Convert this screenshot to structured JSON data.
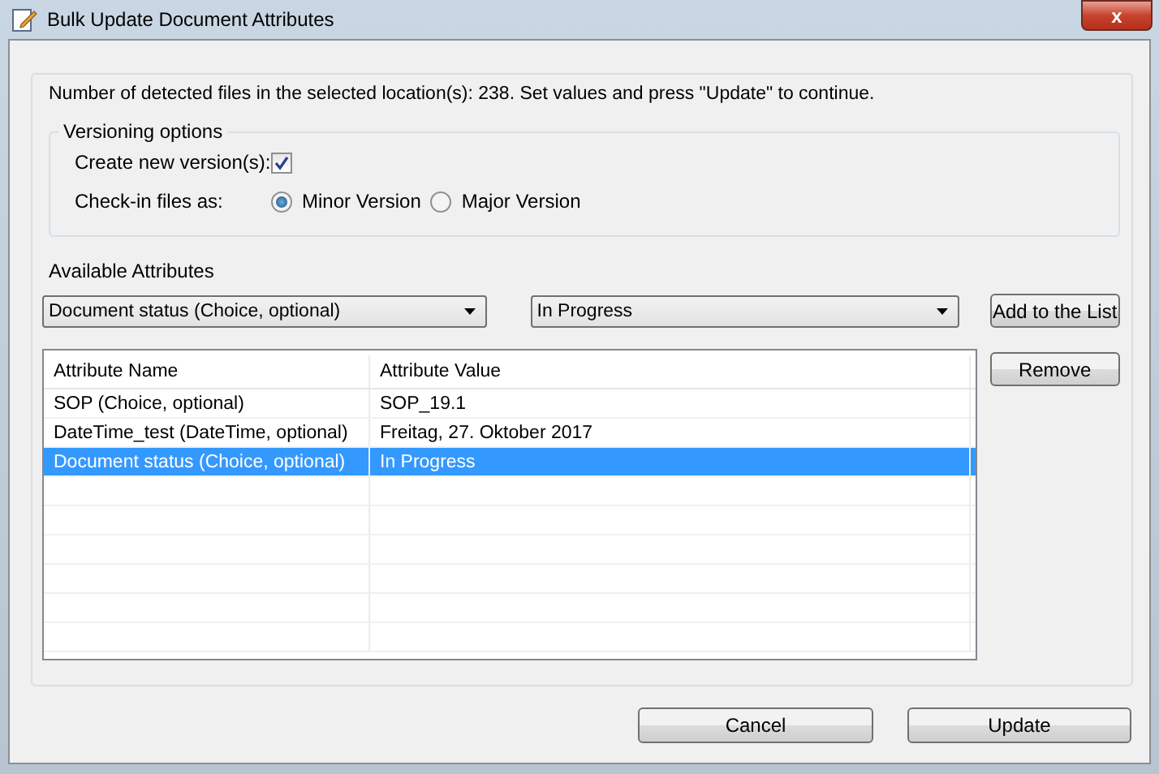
{
  "window": {
    "title": "Bulk Update Document Attributes",
    "close_label": "x"
  },
  "info_text": "Number of detected files in the selected location(s): 238.  Set values and press \"Update\" to continue.",
  "versioning": {
    "title": "Versioning options",
    "create_label": "Create new version(s):",
    "create_checked": true,
    "checkin_label": "Check-in files as:",
    "options": [
      {
        "label": "Minor Version",
        "selected": true
      },
      {
        "label": "Major Version",
        "selected": false
      }
    ]
  },
  "available_label": "Available Attributes",
  "attribute_dropdown": {
    "value": "Document status (Choice, optional)"
  },
  "value_dropdown": {
    "value": "In Progress"
  },
  "add_button": "Add to the List",
  "remove_button": "Remove",
  "table": {
    "columns": [
      "Attribute Name",
      "Attribute Value"
    ],
    "rows": [
      {
        "cells": [
          "SOP (Choice, optional)",
          "SOP_19.1"
        ],
        "selected": false
      },
      {
        "cells": [
          "DateTime_test (DateTime, optional)",
          "Freitag, 27. Oktober 2017"
        ],
        "selected": false
      },
      {
        "cells": [
          "Document status (Choice, optional)",
          "In Progress"
        ],
        "selected": true
      }
    ]
  },
  "buttons": [
    "Cancel",
    "Update"
  ]
}
